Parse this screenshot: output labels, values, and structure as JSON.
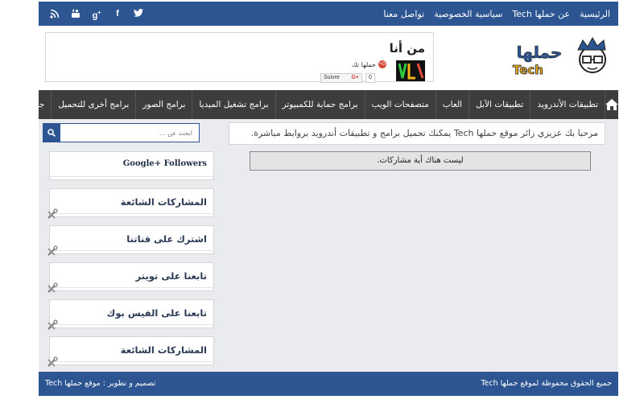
{
  "topbar": {
    "nav": [
      "الرئيسية",
      "عن حملها Tech",
      "سياسية الخصوصية",
      "تواصل معنا"
    ],
    "social_icons": [
      "twitter-icon",
      "facebook-icon",
      "google-plus-icon",
      "youtube-icon",
      "rss-icon"
    ]
  },
  "header": {
    "logo_text": "حملها",
    "logo_sub": "Tech",
    "about_title": "من أنا",
    "gplus_name": "حملها تك",
    "follow_label": "Suivre",
    "follow_count": "0"
  },
  "mainnav": {
    "items": [
      "تطبيقات الأندرويد",
      "تطبيقات الآبل",
      "العاب",
      "متصفحات الويب",
      "برامج حماية للكمبيوتر",
      "برامج تشغيل الميديا",
      "برامج الصور",
      "برامج أخرى للتحميل",
      "جديد التقنية"
    ]
  },
  "main": {
    "welcome": "مرحبا بك عزيزي زائر موقع حملها Tech يمكنك تحميل برامج و تطبيقات أندرويد بروابط مباشرة.",
    "no_posts": "ليست هناك أية مشاركات."
  },
  "sidebar": {
    "search_placeholder": "ابحث عن ...",
    "widgets": [
      "Google+ Followers",
      "المشاركات الشائعة",
      "اشترك على قناتنا",
      "تابعنا على تويتر",
      "تابعنا على الفيس بوك",
      "المشاركات الشائعة"
    ]
  },
  "footer": {
    "copyright": "جميع الحقوق محفوظة لموقع حملها Tech",
    "design": "تصميم و تطوير : موقع حملها Tech"
  },
  "colors": {
    "brand_blue": "#2c5591",
    "nav_dark": "#3d3d3d"
  }
}
